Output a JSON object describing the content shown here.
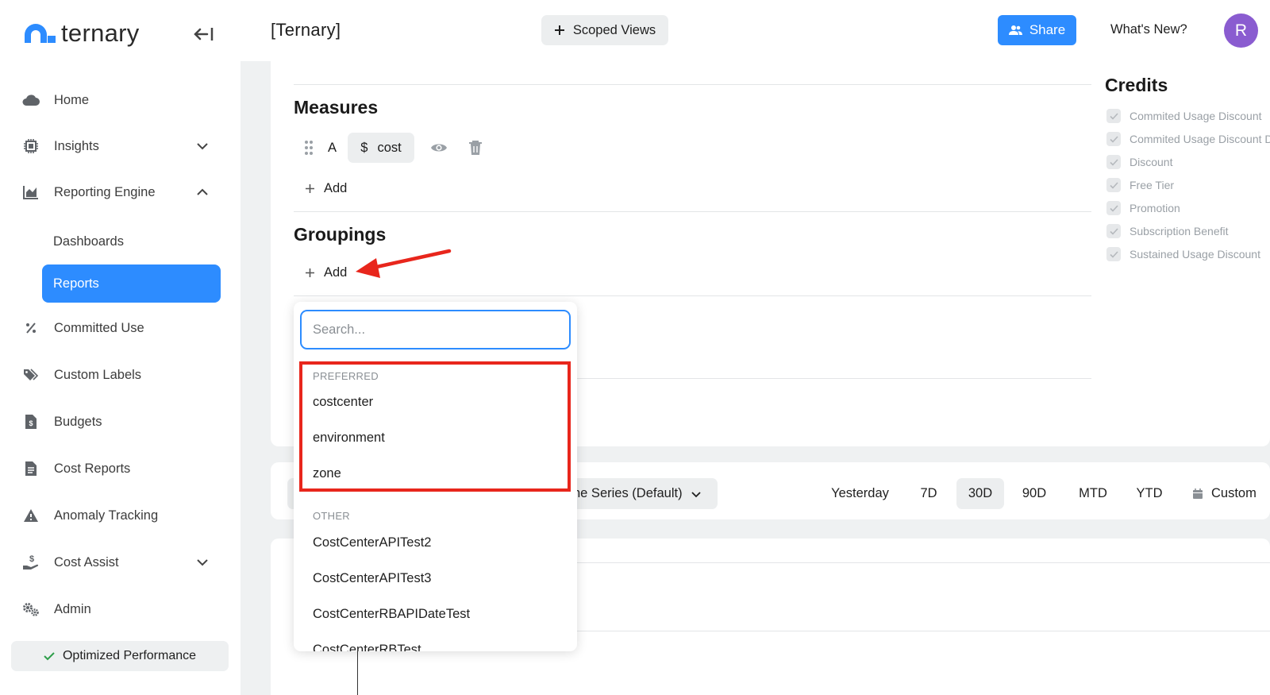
{
  "sidebar": {
    "logo_text": "ternary",
    "items": [
      {
        "label": "Home",
        "icon": "cloud-icon"
      },
      {
        "label": "Insights",
        "icon": "chip-icon"
      },
      {
        "label": "Reporting Engine",
        "icon": "chart-icon"
      },
      {
        "label": "Dashboards"
      },
      {
        "label": "Reports"
      },
      {
        "label": "Committed Use",
        "icon": "percent-icon"
      },
      {
        "label": "Custom Labels",
        "icon": "tags-icon"
      },
      {
        "label": "Budgets",
        "icon": "budget-doc-icon"
      },
      {
        "label": "Cost Reports",
        "icon": "report-doc-icon"
      },
      {
        "label": "Anomaly Tracking",
        "icon": "warning-icon"
      },
      {
        "label": "Cost Assist",
        "icon": "hand-dollar-icon"
      },
      {
        "label": "Admin",
        "icon": "gears-icon"
      }
    ],
    "optimized": "Optimized Performance"
  },
  "header": {
    "title": "[Ternary]",
    "scoped_views": "Scoped Views",
    "share": "Share",
    "whats_new": "What's New?",
    "avatar_initial": "R"
  },
  "measures": {
    "title": "Measures",
    "row": {
      "letter": "A",
      "symbol": "$",
      "name": "cost"
    },
    "add": "Add"
  },
  "groupings": {
    "title": "Groupings",
    "add": "Add"
  },
  "credits": {
    "title": "Credits",
    "items": [
      "Commited Usage Discount",
      "Commited Usage Discount D",
      "Discount",
      "Free Tier",
      "Promotion",
      "Subscription Benefit",
      "Sustained Usage Discount"
    ]
  },
  "toolbar": {
    "time_series": "ne Series (Default)",
    "ranges": [
      "Yesterday",
      "7D",
      "30D",
      "90D",
      "MTD",
      "YTD",
      "Custom"
    ],
    "active_range": "30D"
  },
  "dropdown": {
    "search_placeholder": "Search...",
    "preferred_label": "PREFERRED",
    "preferred": [
      "costcenter",
      "environment",
      "zone"
    ],
    "other_label": "OTHER",
    "other": [
      "CostCenterAPITest2",
      "CostCenterAPITest3",
      "CostCenterRBAPIDateTest",
      "CostCenterRBTest"
    ]
  },
  "colors": {
    "accent": "#2d8cff",
    "annotation": "#e8261c",
    "avatar": "#8a5cd0"
  }
}
